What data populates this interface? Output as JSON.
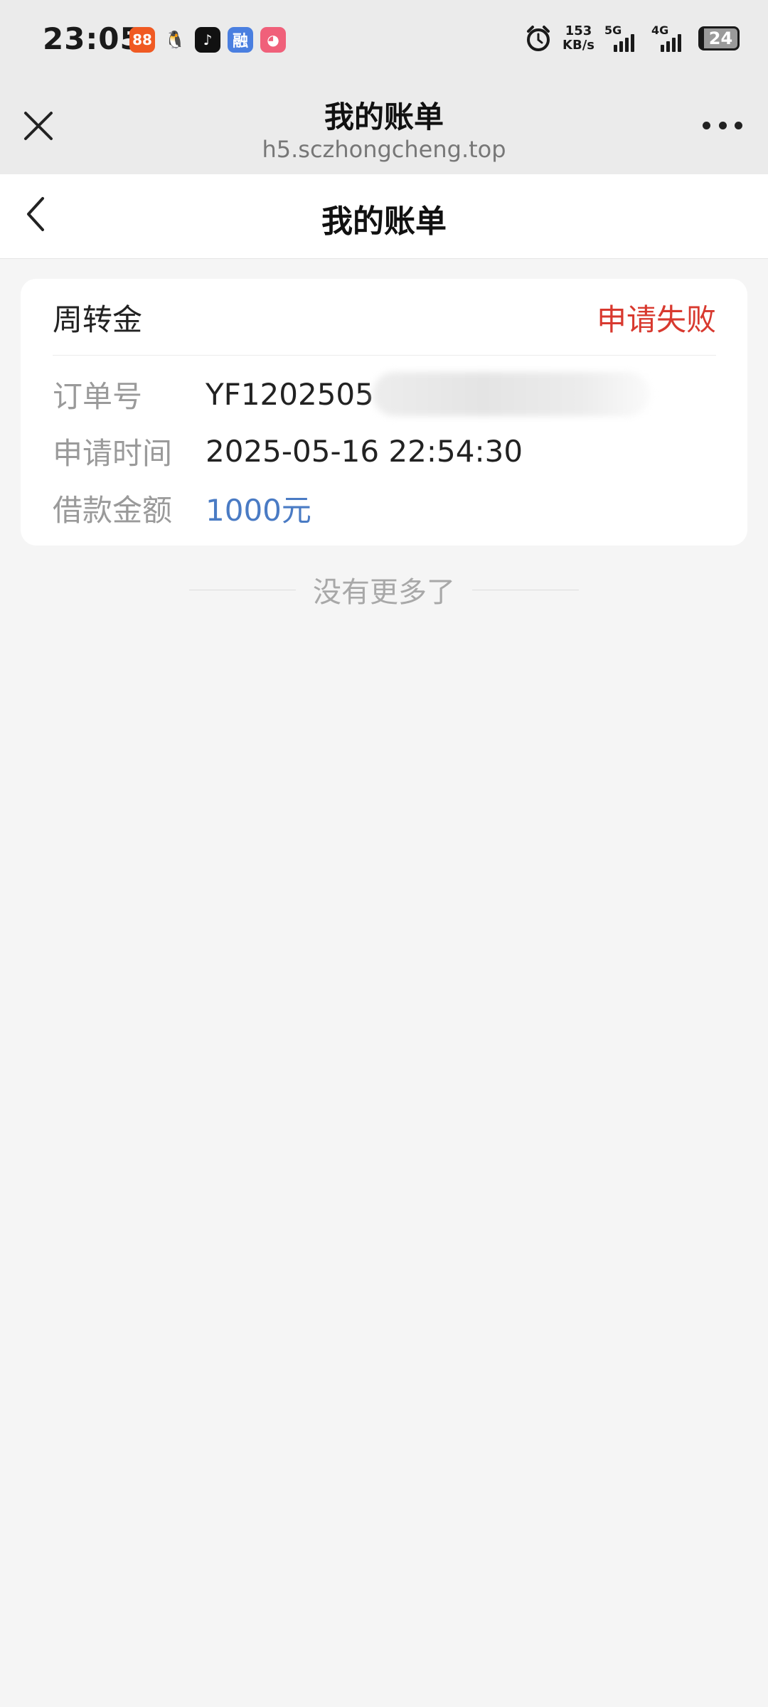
{
  "status_bar": {
    "time": "23:05",
    "app_icons": [
      {
        "name": "kuaishou-icon",
        "color": "#f05a23",
        "glyph": "88"
      },
      {
        "name": "qq-icon",
        "color": "#ebebeb",
        "glyph": "🐧"
      },
      {
        "name": "douyin-icon",
        "color": "#111111",
        "glyph": "♪"
      },
      {
        "name": "rong-icon",
        "color": "#4a7fe0",
        "glyph": "融"
      },
      {
        "name": "app-pink-icon",
        "color": "#f0607a",
        "glyph": "◕"
      }
    ],
    "net_speed_value": "153",
    "net_speed_unit": "KB/s",
    "signal_5g": "5G",
    "signal_4g": "4G",
    "battery": "24"
  },
  "browser": {
    "title": "我的账单",
    "url": "h5.sczhongcheng.top"
  },
  "header": {
    "title": "我的账单"
  },
  "bill": {
    "product": "周转金",
    "status": "申请失败",
    "status_color": "#d8392f",
    "rows": [
      {
        "label": "订单号",
        "value": "YF1202505"
      },
      {
        "label": "申请时间",
        "value": "2025-05-16 22:54:30"
      },
      {
        "label": "借款金额",
        "value": "1000元"
      }
    ],
    "amount_color": "#4a7bc4"
  },
  "footer": {
    "no_more": "没有更多了"
  }
}
